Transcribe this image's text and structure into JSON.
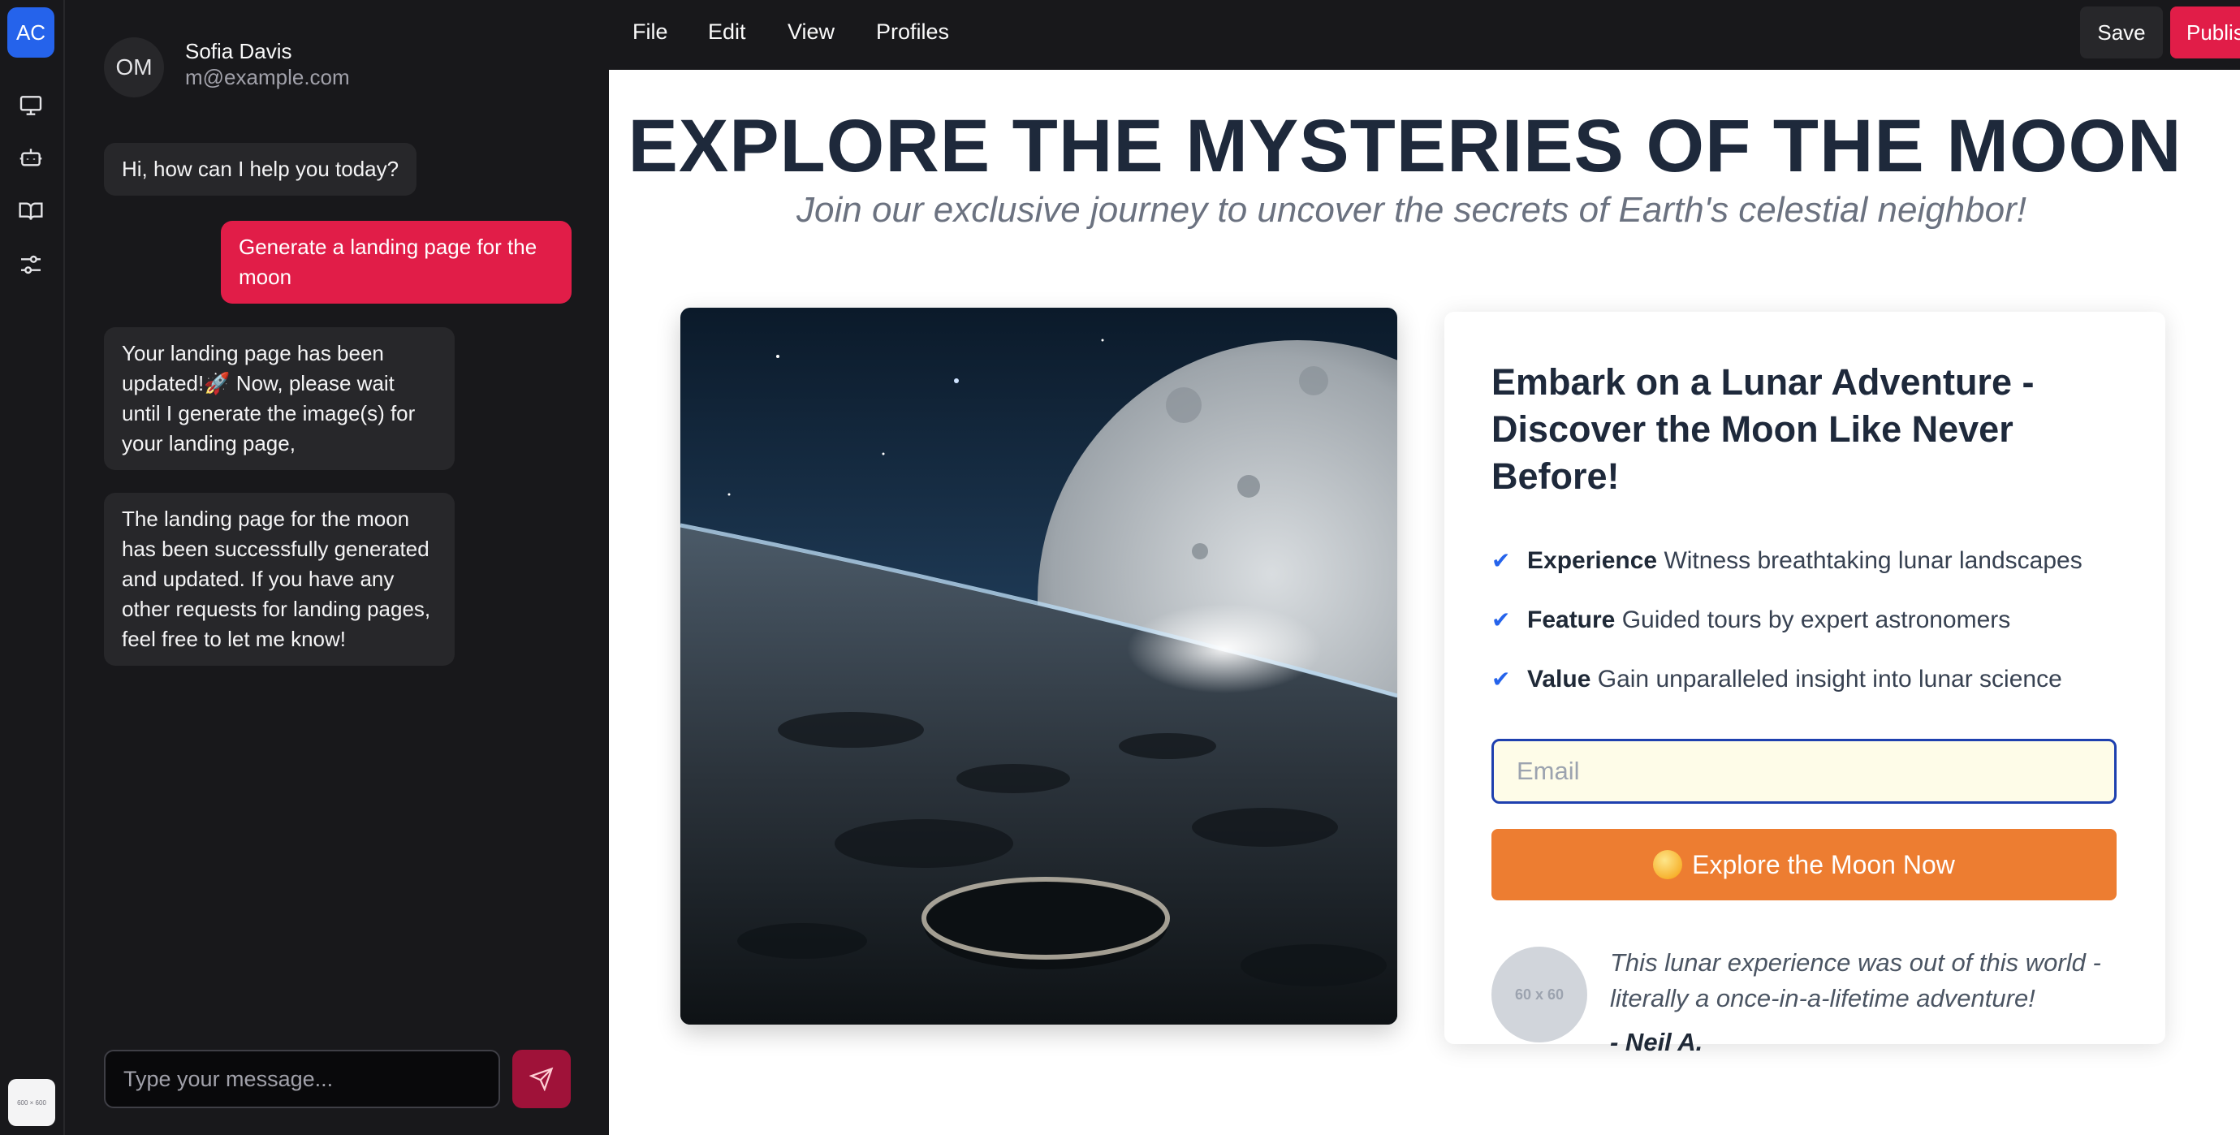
{
  "rail": {
    "workspace_initials": "AC",
    "icons": [
      "monitor-icon",
      "bot-icon",
      "book-icon",
      "sliders-icon"
    ],
    "thumb_label": "600 × 600"
  },
  "chat": {
    "avatar_initials": "OM",
    "user_name": "Sofia Davis",
    "user_email": "m@example.com",
    "messages": [
      {
        "role": "assistant",
        "text": "Hi, how can I help you today?"
      },
      {
        "role": "user",
        "text": "Generate a landing page for the moon"
      },
      {
        "role": "assistant",
        "text": "Your landing page has been updated!🚀 Now, please wait until I generate the image(s) for your landing page,"
      },
      {
        "role": "assistant",
        "text": "The landing page for the moon has been successfully generated and updated. If you have any other requests for landing pages, feel free to let me know!"
      }
    ],
    "composer_placeholder": "Type your message...",
    "send_icon": "send-icon"
  },
  "topbar": {
    "menu": [
      "File",
      "Edit",
      "View",
      "Profiles"
    ],
    "save_label": "Save",
    "publish_label": "Publish"
  },
  "preview": {
    "title": "EXPLORE THE MYSTERIES OF THE MOON",
    "subtitle": "Join our exclusive journey to uncover the secrets of Earth's celestial neighbor!",
    "card": {
      "title": "Embark on a Lunar Adventure - Discover the Moon Like Never Before!",
      "features": [
        {
          "label": "Experience",
          "text": "Witness breathtaking lunar landscapes"
        },
        {
          "label": "Feature",
          "text": "Guided tours by expert astronomers"
        },
        {
          "label": "Value",
          "text": "Gain unparalleled insight into lunar science"
        }
      ],
      "check": "✔",
      "email_placeholder": "Email",
      "cta_label": "Explore the Moon Now",
      "testimonial_avatar": "60 x 60",
      "testimonial_quote": "This lunar experience was out of this world - literally a once-in-a-lifetime adventure!",
      "testimonial_author": "- Neil A."
    }
  },
  "colors": {
    "accent": "#e11d48",
    "cta": "#ed7d31",
    "workspace": "#2563eb",
    "check": "#2563eb"
  }
}
